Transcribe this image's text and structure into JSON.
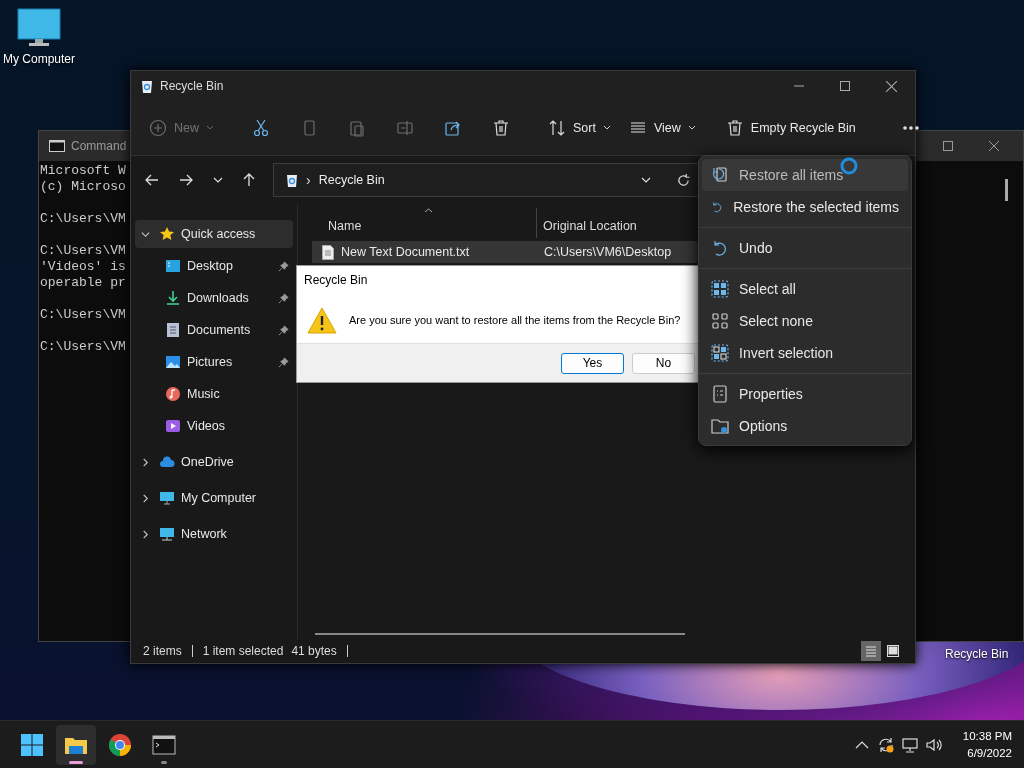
{
  "desktop_icons": [
    {
      "label": "My Computer"
    }
  ],
  "desktop_label": "Recycle Bin",
  "cmd_window": {
    "title": "Command",
    "paragraphs": [
      [
        "Microsoft W",
        "(c) Microso"
      ],
      [
        "C:\\Users\\VM"
      ],
      [
        "C:\\Users\\VM",
        "'Videos' is",
        "operable pr"
      ],
      [
        "C:\\Users\\VM"
      ],
      [
        "C:\\Users\\VM"
      ]
    ]
  },
  "explorer": {
    "title": "Recycle Bin",
    "toolbar": [
      {
        "kind": "new",
        "label": "New",
        "disabled": true
      },
      {
        "kind": "cut",
        "disabled": false
      },
      {
        "kind": "copy",
        "disabled": true
      },
      {
        "kind": "paste",
        "disabled": true
      },
      {
        "kind": "rename",
        "disabled": true
      },
      {
        "kind": "share",
        "disabled": false
      },
      {
        "kind": "delete",
        "disabled": false
      },
      {
        "kind": "sort",
        "label": "Sort",
        "disabled": false
      },
      {
        "kind": "view",
        "label": "View",
        "disabled": false
      },
      {
        "kind": "empty",
        "label": "Empty Recycle Bin",
        "disabled": false
      },
      {
        "kind": "more",
        "disabled": false
      }
    ],
    "address": {
      "separator": "›",
      "path": "Recycle Bin"
    },
    "navigation": [
      {
        "label": "Quick access",
        "kind": "star",
        "expanded": true,
        "selected": true,
        "children": [
          {
            "label": "Desktop",
            "kind": "desktop",
            "pinned": true,
            "selected": false
          },
          {
            "label": "Downloads",
            "kind": "download",
            "pinned": true,
            "selected": false
          },
          {
            "label": "Documents",
            "kind": "document",
            "pinned": true,
            "selected": false
          },
          {
            "label": "Pictures",
            "kind": "picture",
            "pinned": true,
            "selected": false
          },
          {
            "label": "Music",
            "kind": "music",
            "pinned": false,
            "selected": false
          },
          {
            "label": "Videos",
            "kind": "video",
            "pinned": false,
            "selected": false
          }
        ]
      },
      {
        "label": "OneDrive",
        "kind": "cloud",
        "expanded": false,
        "selected": false
      },
      {
        "label": "My Computer",
        "kind": "monitor",
        "expanded": false,
        "selected": false
      },
      {
        "label": "Network",
        "kind": "network",
        "expanded": false,
        "selected": false
      }
    ],
    "columns": [
      {
        "label": "Name",
        "sorted": true
      },
      {
        "label": "Original Location",
        "sorted": false
      }
    ],
    "rows": [
      {
        "name": "New Text Document.txt",
        "location": "C:\\Users\\VM6\\Desktop",
        "selected": true
      }
    ],
    "status_bar": {
      "count": "2 items",
      "selection": "1 item selected",
      "size": "41 bytes",
      "views": [
        {
          "kind": "details",
          "selected": true
        },
        {
          "kind": "preview",
          "selected": false
        }
      ]
    }
  },
  "dialog": {
    "title": "Recycle Bin",
    "message": "Are you sure you want to restore all the items from the Recycle Bin?",
    "buttons": [
      {
        "label": "Yes",
        "default": true
      },
      {
        "label": "No",
        "default": false
      }
    ]
  },
  "menu": {
    "groups": [
      {
        "items": [
          {
            "label": "Restore all items",
            "kind": "restore-all",
            "highlighted": true
          },
          {
            "label": "Restore the selected items",
            "kind": "restore",
            "highlighted": false
          }
        ]
      },
      {
        "items": [
          {
            "label": "Undo",
            "kind": "undo",
            "highlighted": false
          }
        ]
      },
      {
        "items": [
          {
            "label": "Select all",
            "kind": "select-all",
            "highlighted": false
          },
          {
            "label": "Select none",
            "kind": "select-none",
            "highlighted": false
          },
          {
            "label": "Invert selection",
            "kind": "invert",
            "highlighted": false
          }
        ]
      },
      {
        "items": [
          {
            "label": "Properties",
            "kind": "properties",
            "highlighted": false
          },
          {
            "label": "Options",
            "kind": "options",
            "highlighted": false
          }
        ]
      }
    ]
  },
  "taskbar": {
    "apps": [
      {
        "kind": "start",
        "active": false,
        "running": false
      },
      {
        "kind": "explorer",
        "active": true,
        "running": true
      },
      {
        "kind": "chrome",
        "active": false,
        "running": false
      },
      {
        "kind": "terminal",
        "active": false,
        "running": true
      }
    ],
    "tray": [
      {
        "kind": "chevron"
      },
      {
        "kind": "sync"
      },
      {
        "kind": "network"
      },
      {
        "kind": "volume"
      }
    ],
    "time": "10:38 PM",
    "date": "6/9/2022"
  }
}
